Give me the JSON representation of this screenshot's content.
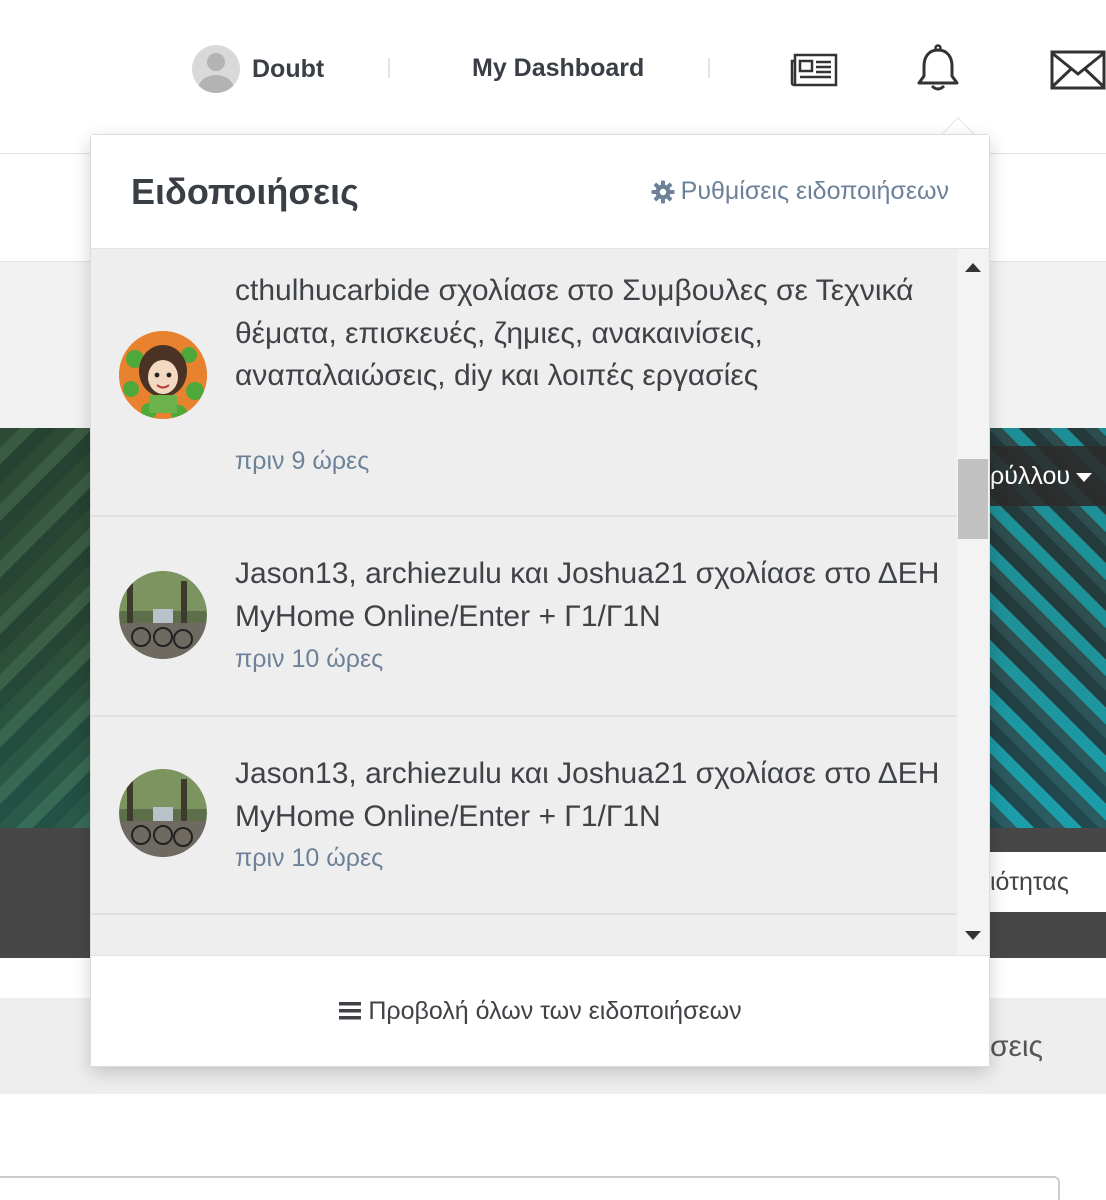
{
  "nav": {
    "user_name": "Doubt",
    "dashboard_label": "My Dashboard",
    "icons": [
      "user-avatar",
      "newspaper-icon",
      "bell-icon",
      "envelope-icon"
    ]
  },
  "background": {
    "hero_dropdown_label": "ρύλλου",
    "privacy_tab_label": "ιότητας",
    "band_label": "σεις"
  },
  "notifications": {
    "title": "Ειδοποιήσεις",
    "settings_label": "Ρυθμίσεις ειδοποιήσεων",
    "settings_icon": "gear-icon",
    "footer_label": "Προβολή όλων των ειδοποιήσεων",
    "footer_icon": "list-icon",
    "items": [
      {
        "text": "cthulhucarbide σχολίασε στο Συμβουλες σε Τεχνικά θέματα, επισκευές, ζημιες, ανακαινίσεις, αναπαλαιώσεις, diy και λοιπές εργασίες",
        "time": "πριν 9 ώρες"
      },
      {
        "text": "Jason13, archiezulu και Joshua21 σχολίασε στο ΔΕΗ MyHome Online/Enter + Γ1/Γ1Ν",
        "time": "πριν 10 ώρες"
      },
      {
        "text": "Jason13, archiezulu και Joshua21 σχολίασε στο ΔΕΗ MyHome Online/Enter + Γ1/Γ1Ν",
        "time": "πριν 10 ώρες"
      }
    ]
  },
  "colors": {
    "link_blue": "#6d8299",
    "text_dark": "#3a3f45",
    "list_bg": "#eeeeee"
  }
}
